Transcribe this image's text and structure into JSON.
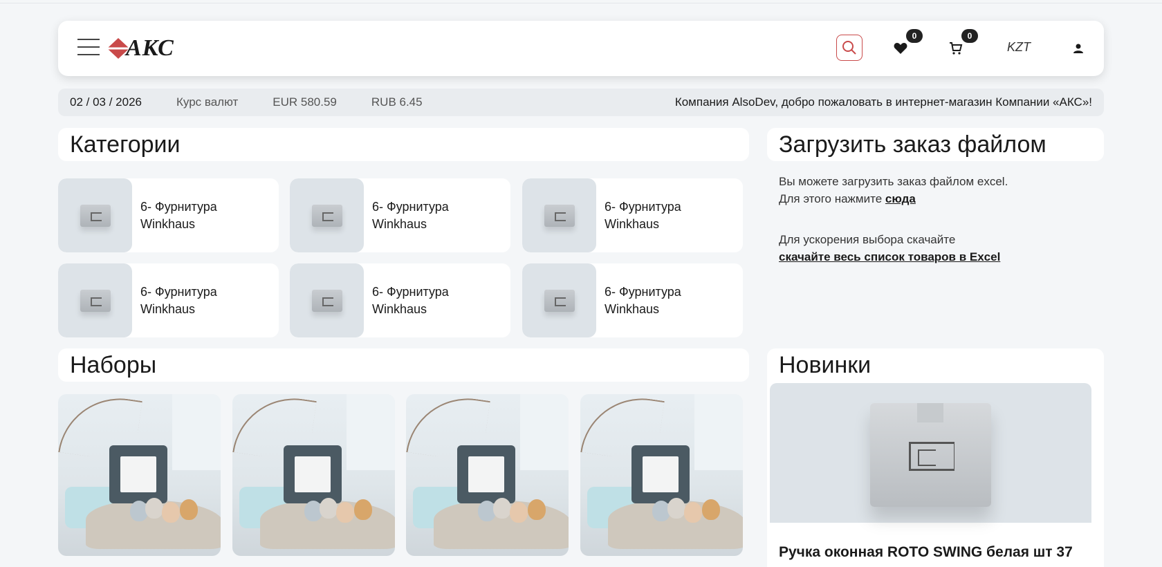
{
  "header": {
    "logo_text": "АКС",
    "currency": "KZT",
    "favorites_count": "0",
    "cart_count": "0"
  },
  "infobar": {
    "date": "02 / 03 / 2026",
    "rate_label": "Курс валют",
    "eur": "EUR 580.59",
    "rub": "RUB 6.45",
    "welcome": "Компания AlsoDev, добро пожаловать в интернет-магазин Компании «АКС»!"
  },
  "categories": {
    "title": "Категории",
    "items": [
      {
        "line1": "6- Фурнитура",
        "line2": "Winkhaus"
      },
      {
        "line1": "6- Фурнитура",
        "line2": "Winkhaus"
      },
      {
        "line1": "6- Фурнитура",
        "line2": "Winkhaus"
      },
      {
        "line1": "6- Фурнитура",
        "line2": "Winkhaus"
      },
      {
        "line1": "6- Фурнитура",
        "line2": "Winkhaus"
      },
      {
        "line1": "6- Фурнитура",
        "line2": "Winkhaus"
      }
    ]
  },
  "upload": {
    "title": "Загрузить заказ файлом",
    "line1": "Вы можете загрузить заказ файлом excel.",
    "line2_prefix": "Для этого нажмите ",
    "line2_link": "сюда",
    "line3": "Для ускорения выбора скачайте",
    "line4_link": "скачайте весь список товаров в Excel"
  },
  "sets": {
    "title": "Наборы"
  },
  "novinki": {
    "title": "Новинки",
    "product_name": "Ручка оконная ROTO SWING белая шт 37"
  },
  "colors": {
    "accent": "#c94a4a",
    "page_bg": "#f4f6f8",
    "thumb_bg": "#dde3e8"
  }
}
